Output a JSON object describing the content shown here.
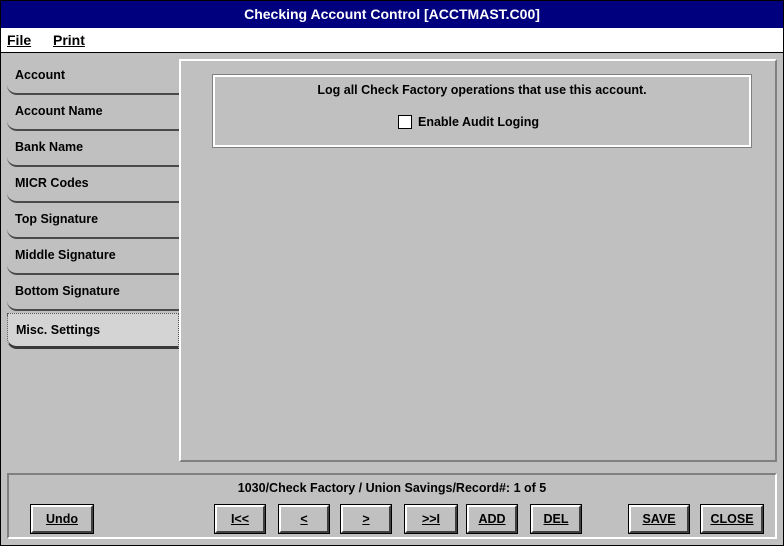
{
  "window": {
    "title": "Checking Account Control [ACCTMAST.C00]"
  },
  "menu": {
    "file": "File",
    "print": "Print"
  },
  "tabs": [
    {
      "label": "Account"
    },
    {
      "label": "Account Name"
    },
    {
      "label": "Bank Name"
    },
    {
      "label": "MICR Codes"
    },
    {
      "label": "Top Signature"
    },
    {
      "label": "Middle Signature"
    },
    {
      "label": "Bottom Signature"
    },
    {
      "label": "Misc. Settings",
      "active": true
    }
  ],
  "misc": {
    "description": "Log all Check Factory operations that use this account.",
    "audit_label": "Enable Audit Loging",
    "audit_checked": false
  },
  "footer": {
    "status": "1030/Check Factory / Union Savings/Record#:  1  of  5",
    "buttons": {
      "undo": "Undo",
      "first": "I<<",
      "prev": "<",
      "next": ">",
      "last": ">>I",
      "add": "ADD",
      "del": "DEL",
      "save": "SAVE",
      "close": "CLOSE"
    }
  }
}
